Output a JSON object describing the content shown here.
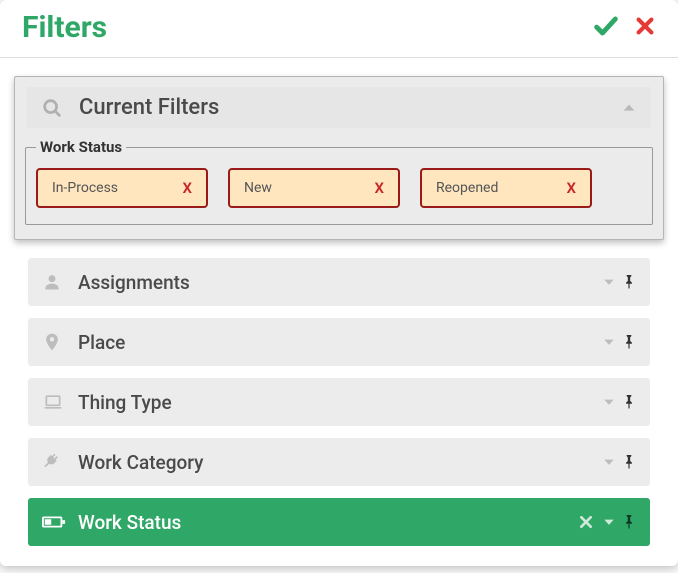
{
  "dialog": {
    "title": "Filters"
  },
  "current_filters": {
    "title": "Current Filters",
    "group_label": "Work Status",
    "chips": [
      {
        "label": "In-Process"
      },
      {
        "label": "New"
      },
      {
        "label": "Reopened"
      }
    ]
  },
  "filters": [
    {
      "id": "assignments",
      "label": "Assignments",
      "icon": "user",
      "active": false,
      "clearable": false
    },
    {
      "id": "place",
      "label": "Place",
      "icon": "pin",
      "active": false,
      "clearable": false
    },
    {
      "id": "thing-type",
      "label": "Thing Type",
      "icon": "laptop",
      "active": false,
      "clearable": false
    },
    {
      "id": "work-category",
      "label": "Work Category",
      "icon": "plug",
      "active": false,
      "clearable": false
    },
    {
      "id": "work-status",
      "label": "Work Status",
      "icon": "battery",
      "active": true,
      "clearable": true
    }
  ],
  "glyphs": {
    "chip_remove": "X"
  }
}
